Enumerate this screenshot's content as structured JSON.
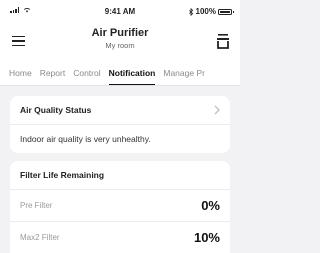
{
  "status_bar": {
    "time": "9:41 AM",
    "battery_text": "100%",
    "icons": [
      "signal-icon",
      "wifi-icon",
      "bluetooth-icon",
      "battery-icon"
    ]
  },
  "header": {
    "title": "Air Purifier",
    "subtitle": "My room",
    "icons": [
      "menu-icon",
      "drawer-icon"
    ]
  },
  "tabs": [
    {
      "label": "Home",
      "active": false
    },
    {
      "label": "Report",
      "active": false
    },
    {
      "label": "Control",
      "active": false
    },
    {
      "label": "Notification",
      "active": true
    },
    {
      "label": "Manage Pr",
      "active": false
    }
  ],
  "air_quality": {
    "heading": "Air Quality Status",
    "message": "Indoor air quality is very unhealthy."
  },
  "filter_life": {
    "heading": "Filter Life Remaining",
    "filters": [
      {
        "name": "Pre Filter",
        "value": "0%"
      },
      {
        "name": "Max2 Filter",
        "value": "10%"
      }
    ]
  },
  "colors": {
    "background": "#f2f2f4",
    "card": "#ffffff",
    "text": "#222222",
    "muted": "#9a9a9e"
  }
}
